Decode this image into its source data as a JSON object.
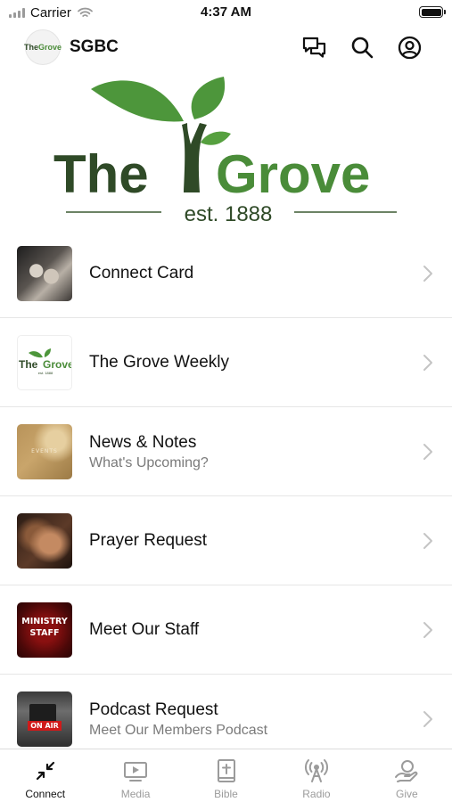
{
  "status_bar": {
    "carrier": "Carrier",
    "time": "4:37 AM"
  },
  "header": {
    "title": "SGBC",
    "logo_text_the": "The",
    "logo_text_grove": "Grove",
    "icons": [
      "chat-icon",
      "search-icon",
      "profile-icon"
    ]
  },
  "banner": {
    "word_the": "The",
    "word_grove": "Grove",
    "tagline": "est. 1888"
  },
  "items": [
    {
      "title": "Connect Card",
      "subtitle": "",
      "thumb": "hands-photo"
    },
    {
      "title": "The Grove Weekly",
      "subtitle": "",
      "thumb": "grove-logo",
      "thumb_the": "The",
      "thumb_grove": "Grove",
      "thumb_est": "est. 1888"
    },
    {
      "title": "News & Notes",
      "subtitle": "What's Upcoming?",
      "thumb": "events-photo",
      "thumb_text": "EVENTS"
    },
    {
      "title": "Prayer Request",
      "subtitle": "",
      "thumb": "praying-hands-photo"
    },
    {
      "title": "Meet Our Staff",
      "subtitle": "",
      "thumb": "ministry-staff-graphic",
      "thumb_line1": "MINISTRY",
      "thumb_line2": "STAFF"
    },
    {
      "title": "Podcast Request",
      "subtitle": "Meet Our Members Podcast",
      "thumb": "on-air-photo",
      "thumb_text": "ON AIR"
    }
  ],
  "tabs": [
    {
      "label": "Connect",
      "icon": "connect-icon",
      "active": true
    },
    {
      "label": "Media",
      "icon": "media-icon",
      "active": false
    },
    {
      "label": "Bible",
      "icon": "bible-icon",
      "active": false
    },
    {
      "label": "Radio",
      "icon": "radio-icon",
      "active": false
    },
    {
      "label": "Give",
      "icon": "give-icon",
      "active": false
    }
  ],
  "colors": {
    "brand_dark": "#2f4a27",
    "brand_green": "#4a8c39",
    "leaf": "#56a03f",
    "active_tab": "#111111",
    "inactive_tab": "#9b9b9b"
  }
}
